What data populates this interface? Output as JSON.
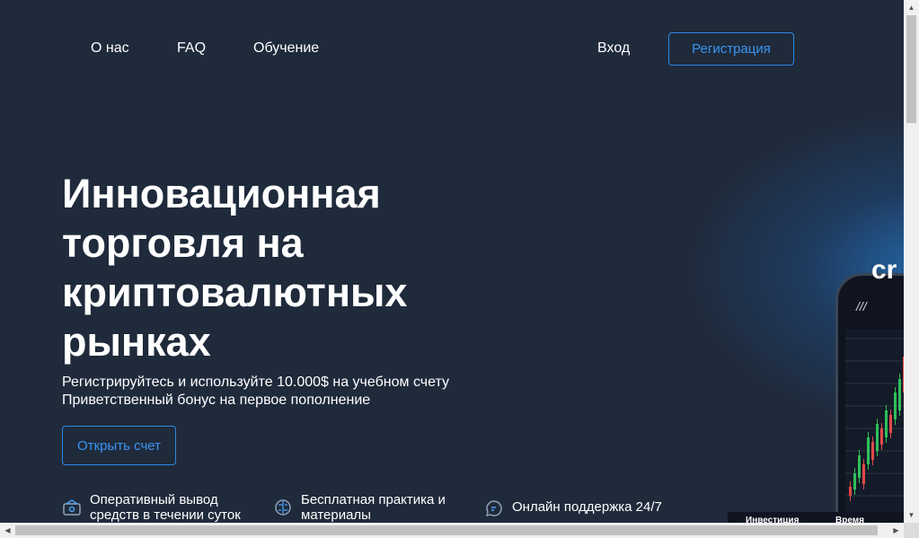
{
  "nav": {
    "about": "О нас",
    "faq": "FAQ",
    "learning": "Обучение",
    "login": "Вход",
    "register": "Регистрация"
  },
  "hero": {
    "title": "Инновационная торговля на криптовалютных рынках",
    "subtitle_1": "Регистрируйтесь и используйте 10.000$ на учебном счету",
    "subtitle_2": "Приветственный бонус на первое пополнение",
    "cta": "Открыть счет"
  },
  "features": [
    {
      "icon": "withdraw-icon",
      "line1": "Оперативный вывод",
      "line2": "средств в течении суток"
    },
    {
      "icon": "brain-icon",
      "line1": "Бесплатная практика и",
      "line2": "материалы"
    },
    {
      "icon": "chat-icon",
      "line1": "Онлайн поддержка 24/7",
      "line2": ""
    }
  ],
  "phone": {
    "logo": "cr",
    "menu": "///",
    "tab_invest": "Инвестиция",
    "tab_time": "Время"
  },
  "colors": {
    "background": "#1f2a3b",
    "accent": "#2d8ae6",
    "candle_up": "#2fbf5a",
    "candle_down": "#e04848"
  }
}
